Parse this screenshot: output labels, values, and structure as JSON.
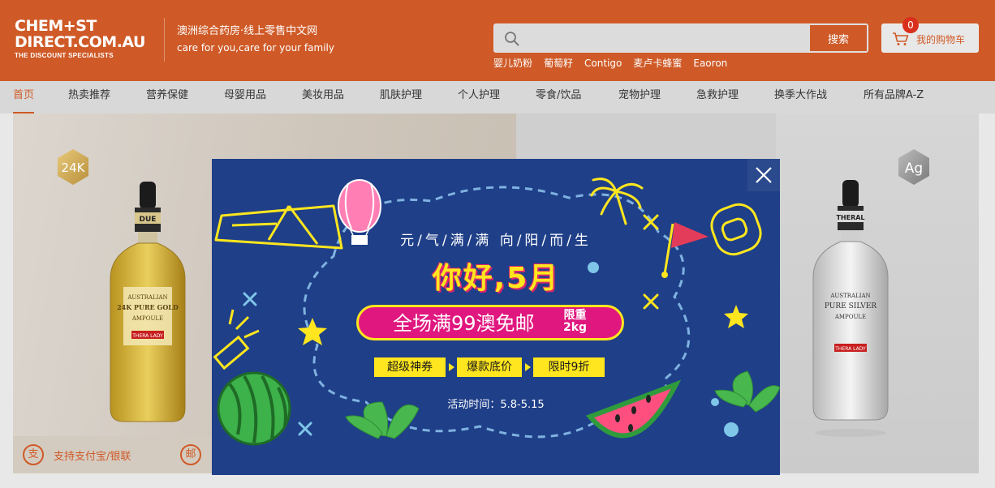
{
  "header": {
    "logo": {
      "line1": "CHEM+ST",
      "line2": "DIRECT.COM.AU",
      "tagline": "THE DISCOUNT SPECIALISTS"
    },
    "slogan_cn": "澳洲综合药房·线上零售中文网",
    "slogan_en": "care for you,care for your family",
    "search": {
      "placeholder": "",
      "button_label": "搜索"
    },
    "hot_keywords": [
      "婴儿奶粉",
      "葡萄籽",
      "Contigo",
      "麦卢卡蜂蜜",
      "Eaoron"
    ],
    "cart": {
      "label": "我的购物车",
      "count": "0"
    },
    "brand_color": "#cf5a27"
  },
  "nav": {
    "items": [
      {
        "label": "首页",
        "active": true
      },
      {
        "label": "热卖推荐",
        "active": false
      },
      {
        "label": "营养保健",
        "active": false
      },
      {
        "label": "母婴用品",
        "active": false
      },
      {
        "label": "美妆用品",
        "active": false
      },
      {
        "label": "肌肤护理",
        "active": false
      },
      {
        "label": "个人护理",
        "active": false
      },
      {
        "label": "零食/饮品",
        "active": false
      },
      {
        "label": "宠物护理",
        "active": false
      },
      {
        "label": "急救护理",
        "active": false
      },
      {
        "label": "换季大作战",
        "active": false
      },
      {
        "label": "所有品牌A-Z",
        "active": false
      }
    ]
  },
  "banner": {
    "gold_badge": "24K",
    "silver_badge": "Ag",
    "gold_bottle": {
      "cap_text": "DUE",
      "line1": "AUSTRALIAN",
      "line2": "24K PURE GOLD",
      "line3": "AMPOULE",
      "brand": "THERA LADY"
    },
    "silver_bottle": {
      "cap_text": "THERAL",
      "line1": "AUSTRALIAN",
      "line2": "PURE SILVER",
      "line3": "AMPOULE",
      "brand": "THERA LADY"
    },
    "features": {
      "alipay_icon_char": "支",
      "alipay_label": "支持支付宝/银联",
      "mail_icon_char": "邮"
    }
  },
  "popup": {
    "subtitle": "元/气/满/满 向/阳/而/生",
    "title": "你好,5月",
    "promo_main": "全场满99澳免邮",
    "promo_limit_line1": "限重",
    "promo_limit_line2": "2kg",
    "tags": [
      "超级神券",
      "爆款底价",
      "限时9折"
    ],
    "date": "活动时间：5.8-5.15",
    "colors": {
      "background": "#1f3f88",
      "yellow": "#ffe61e",
      "pink": "#e0177f"
    }
  }
}
